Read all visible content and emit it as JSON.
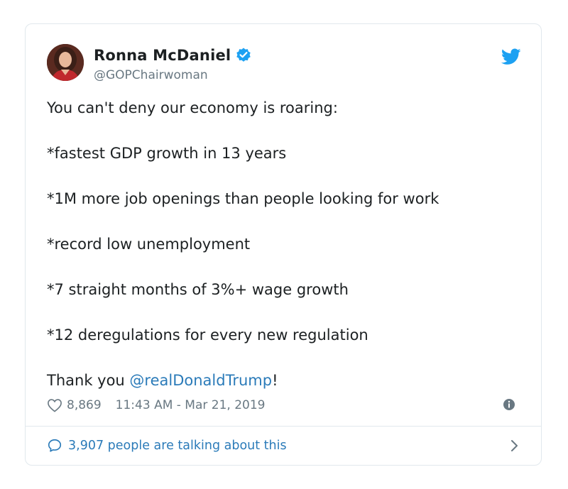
{
  "tweet": {
    "author": {
      "display_name": "Ronna McDaniel",
      "handle": "@GOPChairwoman",
      "verified": true,
      "avatar_icon": "profile-photo"
    },
    "lines": [
      "You can't deny our economy is roaring:",
      "*fastest GDP growth in 13 years",
      "*1M more job openings than people looking for work",
      "*record low unemployment",
      "*7 straight months of 3%+ wage growth",
      "*12 deregulations for every new regulation"
    ],
    "closing_prefix": "Thank you ",
    "mention": "@realDonaldTrump",
    "closing_suffix": "!",
    "likes": "8,869",
    "timestamp": "11:43 AM - Mar 21, 2019",
    "conversation_text": "3,907 people are talking about this"
  },
  "colors": {
    "link": "#2b7bb9",
    "twitter_blue": "#1da1f2",
    "muted": "#697882",
    "border": "#e1e8ed"
  },
  "icons": {
    "brand": "twitter-bird-icon",
    "verified": "verified-badge-icon",
    "like": "heart-icon",
    "info": "info-icon",
    "reply": "speech-bubble-icon",
    "more": "chevron-right-icon"
  }
}
